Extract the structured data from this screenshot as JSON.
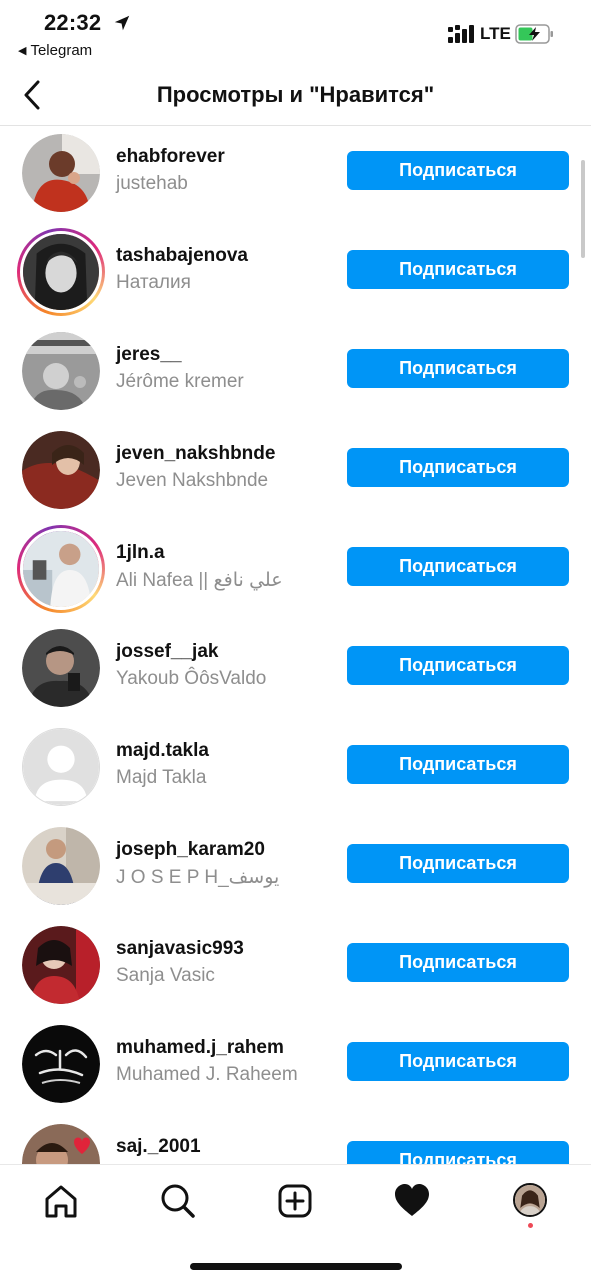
{
  "status_bar": {
    "time": "22:32",
    "back_app": "Telegram",
    "network": "LTE",
    "icons": [
      "location-arrow-icon",
      "signal-icon",
      "battery-charging-icon"
    ]
  },
  "header": {
    "title": "Просмотры и \"Нравится\"",
    "back_icon": "chevron-left-icon"
  },
  "users": [
    {
      "username": "ehabforever",
      "full_name": "justehab",
      "button": "Подписаться",
      "story_ring": false
    },
    {
      "username": "tashabajenova",
      "full_name": "Наталия",
      "button": "Подписаться",
      "story_ring": true
    },
    {
      "username": "jeres__",
      "full_name": "Jérôme kremer",
      "button": "Подписаться",
      "story_ring": false
    },
    {
      "username": "jeven_nakshbnde",
      "full_name": "Jeven Nakshbnde",
      "button": "Подписаться",
      "story_ring": false
    },
    {
      "username": "1jln.a",
      "full_name": "Ali Nafea || علي نافع",
      "button": "Подписаться",
      "story_ring": true
    },
    {
      "username": "jossef__jak",
      "full_name": "Yakoub ÔôsValdo",
      "button": "Подписаться",
      "story_ring": false
    },
    {
      "username": "majd.takla",
      "full_name": "Majd Takla",
      "button": "Подписаться",
      "story_ring": false
    },
    {
      "username": "joseph_karam20",
      "full_name": "J O S E P H_يوسف",
      "button": "Подписаться",
      "story_ring": false
    },
    {
      "username": "sanjavasic993",
      "full_name": "Sanja Vasic",
      "button": "Подписаться",
      "story_ring": false
    },
    {
      "username": "muhamed.j_rahem",
      "full_name": "Muhamed J. Raheem",
      "button": "Подписаться",
      "story_ring": false
    },
    {
      "username": "saj._2001",
      "full_name": "",
      "button": "Подписаться",
      "story_ring": false
    }
  ],
  "tab_bar": {
    "tabs": [
      "home-icon",
      "search-icon",
      "new-post-icon",
      "activity-heart-icon",
      "profile-avatar"
    ]
  },
  "colors": {
    "follow_button": "#0095f6",
    "secondary_text": "#8e8e8e",
    "notification_dot": "#ed4956"
  }
}
